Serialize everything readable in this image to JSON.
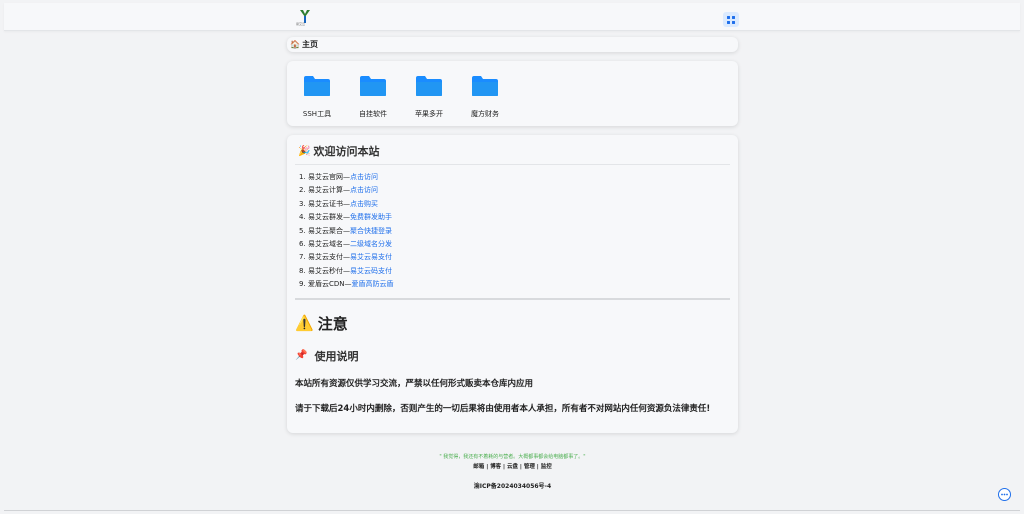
{
  "header": {
    "logo_text": "易艾云",
    "menu_icon": "grid-icon"
  },
  "breadcrumb": {
    "icon": "home-icon",
    "label": "主页"
  },
  "apps": [
    {
      "label": "SSH工具",
      "icon": "folder-icon"
    },
    {
      "label": "自挂软件",
      "icon": "folder-icon"
    },
    {
      "label": "苹果多开",
      "icon": "folder-icon"
    },
    {
      "label": "魔方财务",
      "icon": "folder-icon"
    }
  ],
  "welcome": {
    "emoji": "🎉",
    "title": "欢迎访问本站",
    "items": [
      {
        "num": "1.",
        "text": "易艾云官网—",
        "link": "点击访问"
      },
      {
        "num": "2.",
        "text": "易艾云计算—",
        "link": "点击访问"
      },
      {
        "num": "3.",
        "text": "易艾云证书—",
        "link": "点击购买"
      },
      {
        "num": "4.",
        "text": "易艾云群发—",
        "link": "免费群发助手"
      },
      {
        "num": "5.",
        "text": "易艾云聚合—",
        "link": "聚合快捷登录"
      },
      {
        "num": "6.",
        "text": "易艾云域名—",
        "link": "二级域名分发"
      },
      {
        "num": "7.",
        "text": "易艾云支付—",
        "link": "易艾云易支付"
      },
      {
        "num": "8.",
        "text": "易艾云秒付—",
        "link": "易艾云码支付"
      },
      {
        "num": "9.",
        "text": "爱盾云CDN—",
        "link": "爱盾高防云盾"
      }
    ]
  },
  "notice": {
    "icon": "⚠️",
    "title": "注意",
    "usage_icon": "📌",
    "usage_title": "使用说明",
    "paragraph1": "本站所有资源仅供学习交流，严禁以任何形式贩卖本仓库内应用",
    "paragraph2": "请于下载后24小时内删除，否则产生的一切后果将由使用者本人承担，所有者不对网站内任何资源负法律责任!"
  },
  "footer": {
    "quote": "\" 我觉得，我还有不着耗的与营者。大概都事都会给电脑都事了。\"",
    "links": [
      "邮箱",
      "博客",
      "云盘",
      "管理",
      "监控"
    ],
    "separator": " | ",
    "icp": "渝ICP备2024034056号-4"
  },
  "colors": {
    "link": "#1f6feb",
    "folder": "#1a8cff",
    "quote": "#4caf50"
  }
}
